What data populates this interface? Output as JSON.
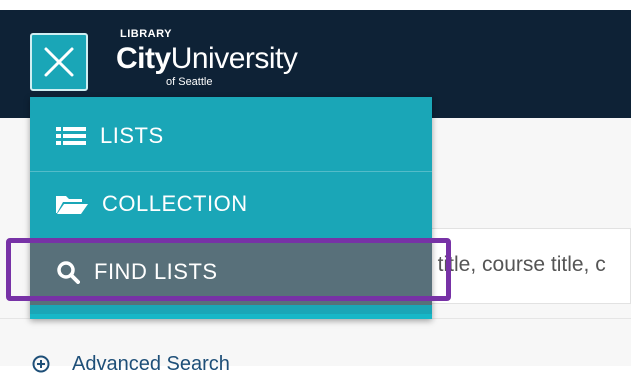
{
  "header": {
    "logo": {
      "library": "LIBRARY",
      "city": "City",
      "university": "University",
      "sub": "of Seattle"
    }
  },
  "menu": {
    "items": [
      {
        "label": "LISTS",
        "icon": "list-icon"
      },
      {
        "label": "COLLECTION",
        "icon": "folder-open-icon"
      },
      {
        "label": "FIND LISTS",
        "icon": "search-icon",
        "active": true
      }
    ]
  },
  "search": {
    "placeholder": "t title, course title, c"
  },
  "advanced_search": {
    "label": "Advanced Search",
    "icon": "plus-circle-icon"
  },
  "colors": {
    "header_bg": "#0e2236",
    "menu_bg": "#1aa6b7",
    "active_item_bg": "#58707a",
    "highlight_border": "#7732a6",
    "link": "#1e4f78"
  }
}
